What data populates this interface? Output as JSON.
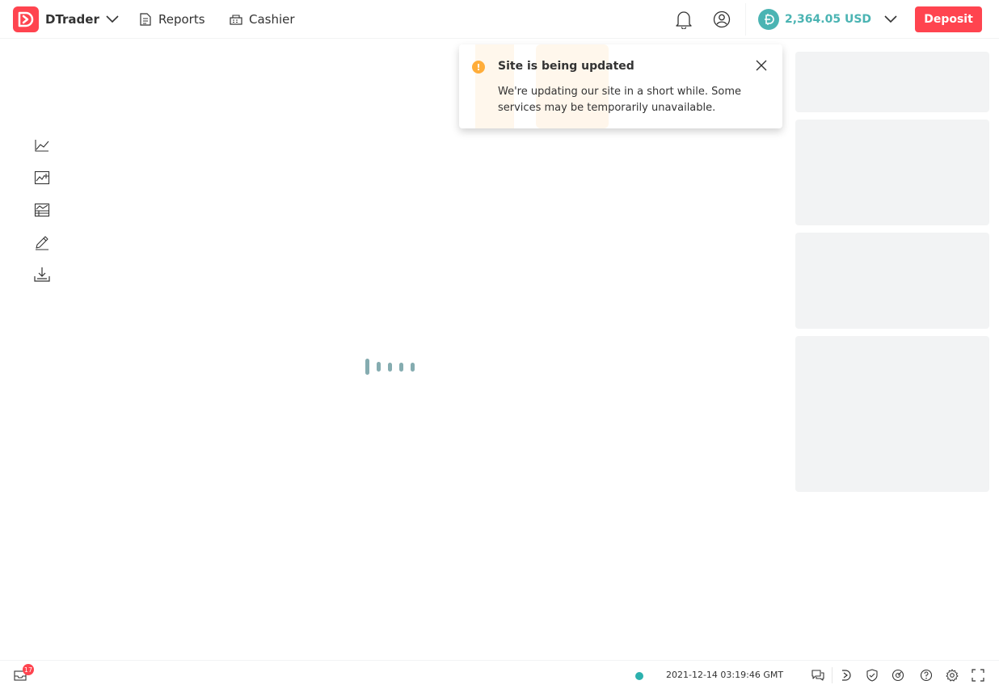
{
  "header": {
    "app_name": "DTrader",
    "nav": [
      {
        "label": "Reports",
        "icon": "reports-icon"
      },
      {
        "label": "Cashier",
        "icon": "cashier-icon"
      }
    ],
    "balance": "2,364.05 USD",
    "deposit_label": "Deposit"
  },
  "toast": {
    "title": "Site is being updated",
    "body": "We're updating our site in a short while. Some services may be temporarily unavailable."
  },
  "chart_tools": [
    "chart-type-icon",
    "indicators-icon",
    "studies-icon",
    "drawing-tools-icon",
    "download-icon"
  ],
  "footer": {
    "notification_count": "17",
    "server_time": "2021-12-14 03:19:46 GMT"
  },
  "colors": {
    "brand": "#ff444f",
    "balance": "#4bb4b3",
    "warning": "#ffad3a",
    "status_online": "#2cb1ae"
  }
}
